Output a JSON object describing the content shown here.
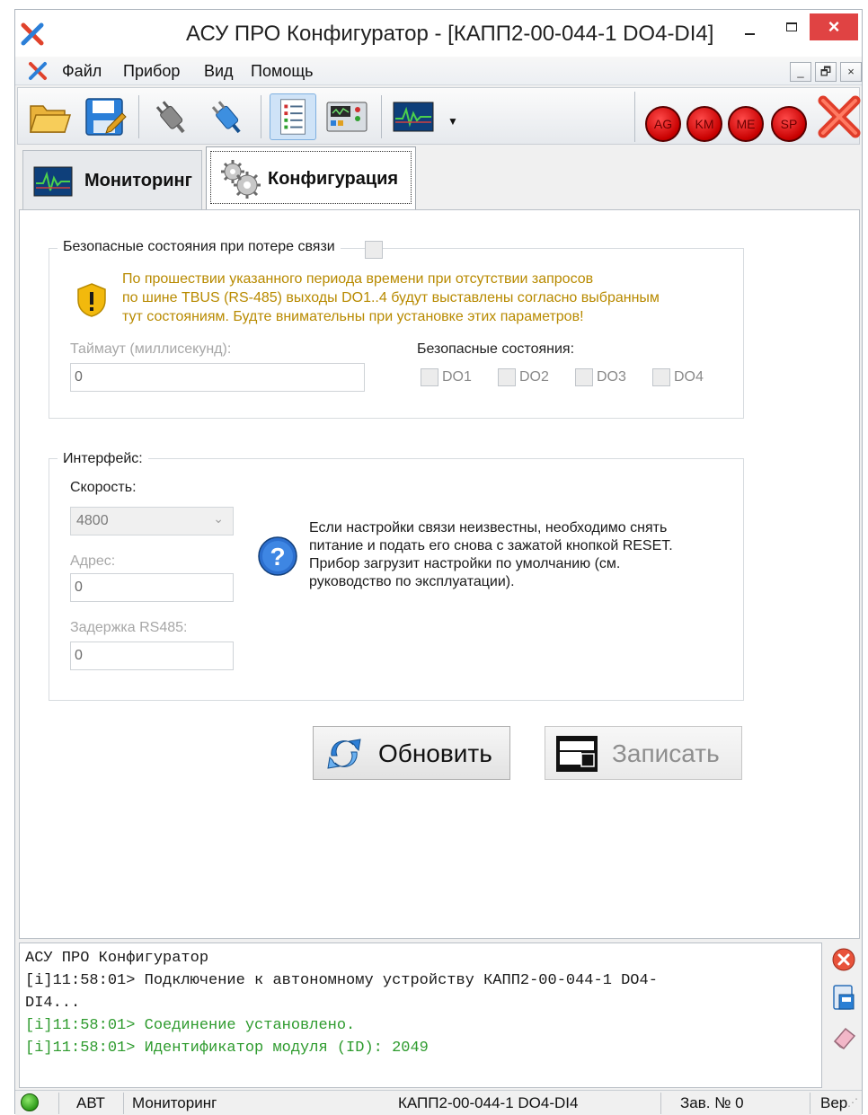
{
  "window": {
    "title": "АСУ ПРО Конфигуратор - [КАПП2-00-044-1 DO4-DI4]",
    "controls": {
      "minimize": "minimize",
      "maximize": "maximize",
      "close": "×"
    }
  },
  "menu": {
    "items": [
      "Файл",
      "Прибор",
      "Вид",
      "Помощь"
    ],
    "mdi_buttons": [
      "_",
      "🗗",
      "×"
    ]
  },
  "toolbar": {
    "buttons": [
      "open-folder-icon",
      "save-icon",
      "disconnect-plug-icon",
      "connect-plug-icon",
      "checklist-icon",
      "device-panel-icon",
      "monitoring-chart-icon"
    ],
    "indicators": [
      "AG",
      "KM",
      "ME",
      "SP"
    ],
    "colors": {
      "indicator": "#d00000",
      "accent": "#2a7fd4"
    }
  },
  "tabs": [
    {
      "label": "Мониторинг",
      "active": false
    },
    {
      "label": "Конфигурация",
      "active": true
    }
  ],
  "safe_states": {
    "legend": "Безопасные состояния при потере связи",
    "enabled": false,
    "warning_lines": [
      "По прошествии указанного периода времени при отсутствии запросов",
      "по шине TBUS (RS-485) выходы DO1..4 будут выставлены согласно выбранным",
      "тут состояниям. Будте внимательны при установке этих параметров!"
    ],
    "timeout_label": "Таймаут (миллисекунд):",
    "timeout_value": "0",
    "states_label": "Безопасные состояния:",
    "outputs": [
      "DO1",
      "DO2",
      "DO3",
      "DO4"
    ]
  },
  "interface": {
    "legend": "Интерфейс:",
    "speed_label": "Скорость:",
    "speed_value": "4800",
    "address_label": "Адрес:",
    "address_value": "0",
    "delay_label": "Задержка RS485:",
    "delay_value": "0",
    "info_lines": [
      "Если настройки связи неизвестны, необходимо снять",
      "питание и подать его снова с зажатой кнопкой RESET.",
      "Прибор загрузит настройки по умолчанию (см.",
      "руководство по эксплуатации)."
    ]
  },
  "actions": {
    "refresh": "Обновить",
    "write": "Записать"
  },
  "log": {
    "lines": [
      {
        "text": "АСУ ПРО Конфигуратор",
        "type": "normal"
      },
      {
        "text": "[i]11:58:01> Подключение к автономному устройству КАПП2-00-044-1 DO4-",
        "type": "normal"
      },
      {
        "text": "DI4...",
        "type": "normal"
      },
      {
        "text": "[i]11:58:01> Соединение установлено.",
        "type": "success"
      },
      {
        "text": "[i]11:58:01> Идентификатор модуля (ID): 2049",
        "type": "success"
      }
    ],
    "side_buttons": [
      "clear-log-icon",
      "copy-log-icon",
      "eraser-icon"
    ]
  },
  "status": {
    "mode": "АВТ",
    "view": "Мониторинг",
    "device": "КАПП2-00-044-1 DO4-DI4",
    "serial_label": "Зав. № 0",
    "version_label": "Вер",
    "connected": true
  }
}
